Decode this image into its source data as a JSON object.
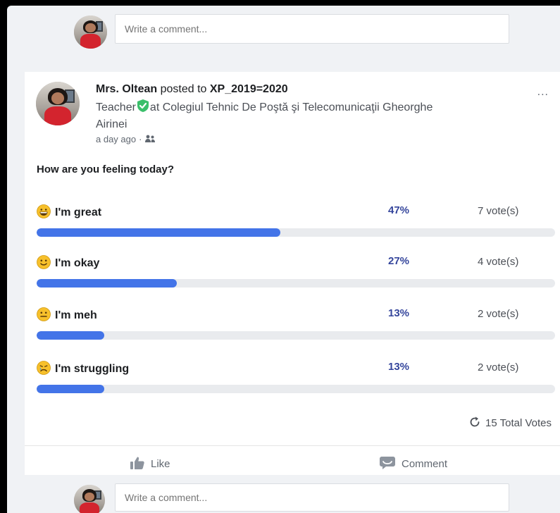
{
  "top_comment": {
    "placeholder": "Write a comment..."
  },
  "post": {
    "author": "Mrs. Oltean",
    "posted_to_text": "posted to",
    "group": "XP_2019=2020",
    "teacher_prefix": "Teacher",
    "school": "at Colegiul Tehnic De Poştă şi Telecomunicaţii Gheorghe Airinei",
    "time": "a day ago",
    "time_separator": "·",
    "more": "..."
  },
  "poll": {
    "question": "How are you feeling today?",
    "options": [
      {
        "label": "I'm great",
        "percent": "47%",
        "votes": "7 vote(s)",
        "fill": 0.47,
        "emoji": "grinning-face-icon"
      },
      {
        "label": "I'm okay",
        "percent": "27%",
        "votes": "4 vote(s)",
        "fill": 0.27,
        "emoji": "slightly-smiling-face-icon"
      },
      {
        "label": "I'm meh",
        "percent": "13%",
        "votes": "2 vote(s)",
        "fill": 0.13,
        "emoji": "neutral-face-icon"
      },
      {
        "label": "I'm struggling",
        "percent": "13%",
        "votes": "2 vote(s)",
        "fill": 0.13,
        "emoji": "crying-face-icon"
      }
    ],
    "total": "15 Total Votes"
  },
  "actions": {
    "like": "Like",
    "comment": "Comment"
  },
  "bottom_comment": {
    "placeholder": "Write a comment..."
  },
  "colors": {
    "accent": "#4374e8",
    "percent_text": "#35469c",
    "verified": "#3bbf6b"
  }
}
